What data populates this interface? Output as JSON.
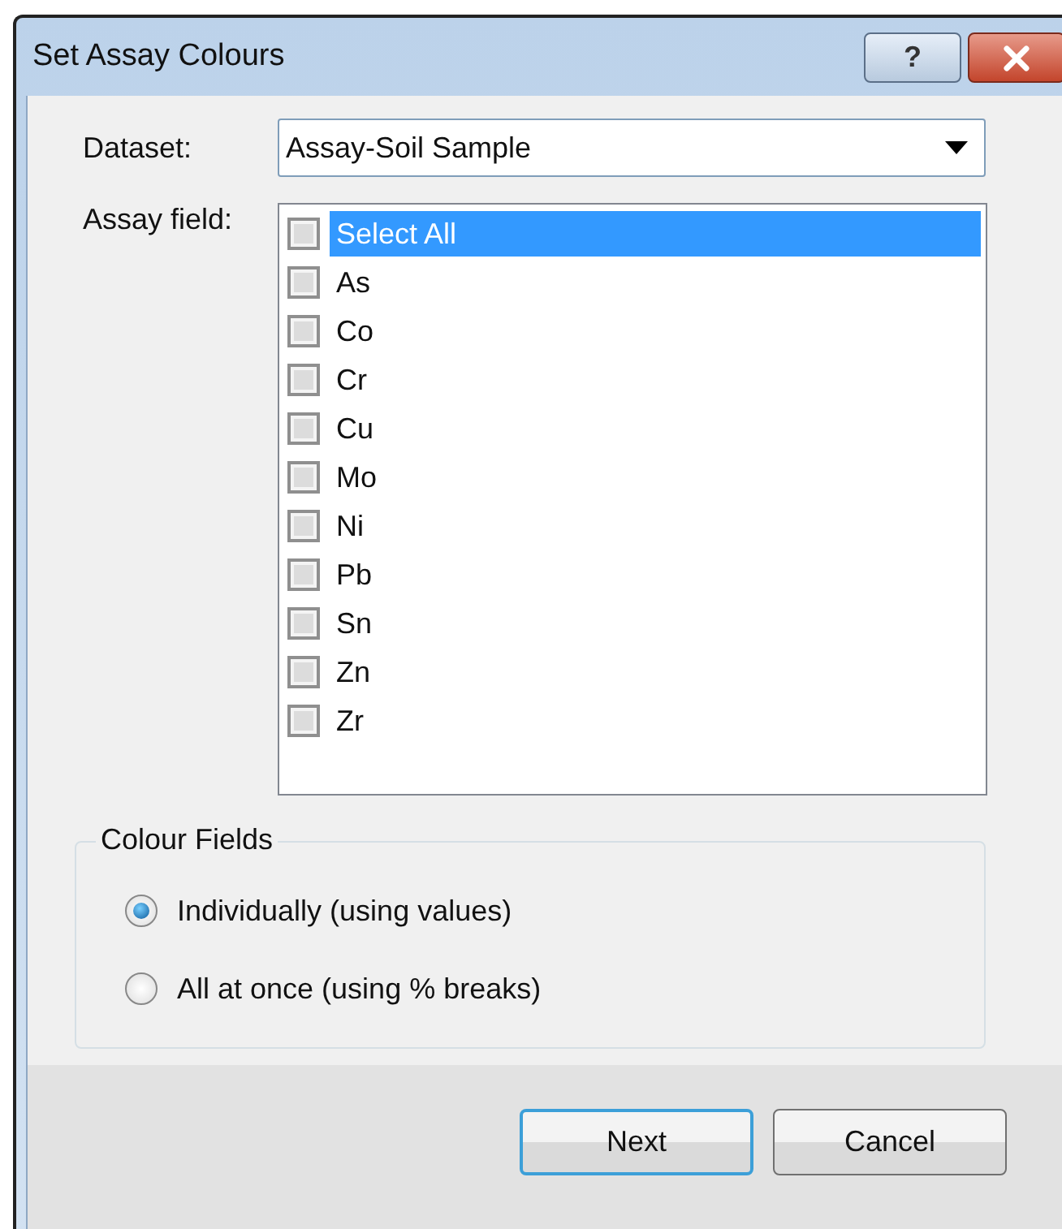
{
  "window": {
    "title": "Set Assay Colours"
  },
  "title_buttons": [
    {
      "kind": "help",
      "label": "?"
    },
    {
      "kind": "close"
    }
  ],
  "dataset": {
    "label": "Dataset:",
    "value": "Assay-Soil Sample"
  },
  "assay_field": {
    "label": "Assay field:",
    "items": [
      {
        "label": "Select All",
        "checked": false,
        "selected": true
      },
      {
        "label": "As",
        "checked": false,
        "selected": false
      },
      {
        "label": "Co",
        "checked": false,
        "selected": false
      },
      {
        "label": "Cr",
        "checked": false,
        "selected": false
      },
      {
        "label": "Cu",
        "checked": false,
        "selected": false
      },
      {
        "label": "Mo",
        "checked": false,
        "selected": false
      },
      {
        "label": "Ni",
        "checked": false,
        "selected": false
      },
      {
        "label": "Pb",
        "checked": false,
        "selected": false
      },
      {
        "label": "Sn",
        "checked": false,
        "selected": false
      },
      {
        "label": "Zn",
        "checked": false,
        "selected": false
      },
      {
        "label": "Zr",
        "checked": false,
        "selected": false
      }
    ]
  },
  "colour_fields": {
    "title": "Colour Fields",
    "options": [
      {
        "label": "Individually (using values)",
        "selected": true
      },
      {
        "label": "All at once (using % breaks)",
        "selected": false
      }
    ]
  },
  "buttons": [
    {
      "label": "Next",
      "default": true
    },
    {
      "label": "Cancel",
      "default": false
    }
  ]
}
